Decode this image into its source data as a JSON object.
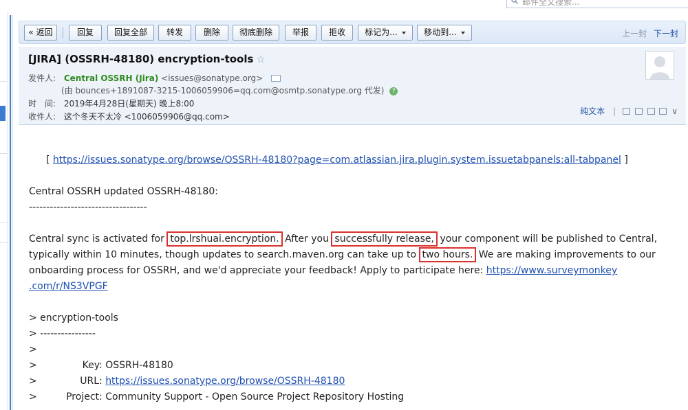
{
  "top": {
    "search_placeholder": "邮件全文搜索..."
  },
  "toolbar": {
    "back": "« 返回",
    "reply": "回复",
    "reply_all": "回复全部",
    "forward": "转发",
    "delete": "删除",
    "perm_delete": "彻底删除",
    "report": "举报",
    "reject": "拒收",
    "mark_as": "标记为...",
    "move_to": "移动到...",
    "prev": "上一封",
    "next": "下一封"
  },
  "header": {
    "subject": "[JIRA] (OSSRH-48180) encryption-tools",
    "star": "☆",
    "from_label": "发件人:",
    "sender_name": "Central OSSRH (Jira)",
    "sender_email": "<issues@sonatype.org>",
    "via": "(由 bounces+1891087-3215-1006059906=qq.com@osmtp.sonatype.org 代发)",
    "via_help": "?",
    "time_label": "时　间:",
    "time_value": "2019年4月28日(星期天) 晚上8:00",
    "to_label": "收件人:",
    "to_value": "这个冬天不太冷 <1006059906@qq.com>",
    "plain_text": "纯文本",
    "expand": "∨"
  },
  "body": {
    "link_open": "[",
    "issue_tab_link": "https://issues.sonatype.org/browse/OSSRH-48180?page=com.atlassian.jira.plugin.system.issuetabpanels:all-tabpanel",
    "link_close": "]",
    "updated": "Central OSSRH updated OSSRH-48180:",
    "divider": "----------------------------------",
    "p1_a": "Central sync is activated for ",
    "p1_hl1": "top.lrshuai.encryption.",
    "p1_b": " After you ",
    "p1_hl2": "successfully release,",
    "p1_c": " your component will be published to Central,",
    "p2_a": "typically within 10 minutes, though updates to search.maven.org can take up to ",
    "p2_hl3": "two hours.",
    "p2_b": "  We are making improvements to our",
    "p3_a": "onboarding process for OSSRH, and we'd appreciate your feedback!  Apply to participate here: ",
    "survey_link_1": "https://www.surveymonkey",
    "survey_link_2": ".com/r/NS3VPGF",
    "q1": "> encryption-tools",
    "q2": "> ----------------",
    "q3": ">",
    "q4_prefix": ">",
    "q4_label": "Key:",
    "q4_value": "OSSRH-48180",
    "q5_prefix": ">",
    "q5_label": "URL:",
    "q5_link": "https://issues.sonatype.org/browse/OSSRH-48180",
    "q6_prefix": ">",
    "q6_label": "Project:",
    "q6_value": "Community Support - Open Source Project Repository Hosting"
  },
  "colors": {
    "accent": "#2553a8",
    "sender_green": "#2f8a1f",
    "highlight_red": "#d9312f",
    "header_bg": "#eef3fa"
  }
}
